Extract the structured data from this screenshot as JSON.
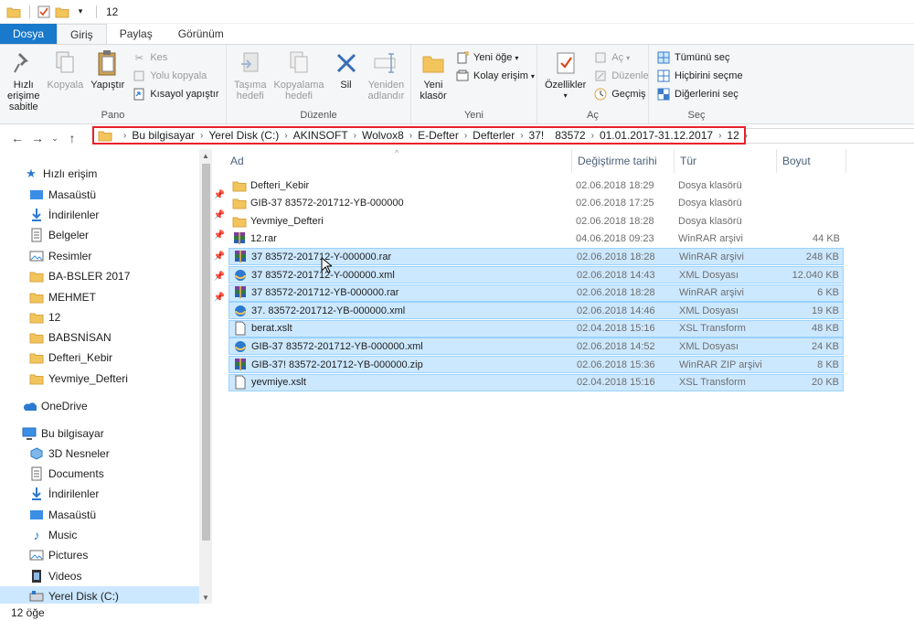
{
  "titlebar": {
    "title": "12"
  },
  "ribbon_tabs": [
    "Dosya",
    "Giriş",
    "Paylaş",
    "Görünüm"
  ],
  "ribbon": {
    "pano": {
      "label": "Pano",
      "pin_label_1": "Hızlı erişime",
      "pin_label_2": "sabitle",
      "copy_label": "Kopyala",
      "paste_label": "Yapıştır",
      "cut_label": "Kes",
      "copy_path_label": "Yolu kopyala",
      "paste_shortcut_label": "Kısayol yapıştır"
    },
    "duzenle": {
      "label": "Düzenle",
      "move_label_1": "Taşıma",
      "move_label_2": "hedefi",
      "copyto_label_1": "Kopyalama",
      "copyto_label_2": "hedefi",
      "delete_label": "Sil",
      "rename_label_1": "Yeniden",
      "rename_label_2": "adlandır"
    },
    "yeni": {
      "label": "Yeni",
      "new_folder_label_1": "Yeni",
      "new_folder_label_2": "klasör",
      "new_item_label": "Yeni öğe",
      "easy_access_label": "Kolay erişim"
    },
    "ac": {
      "label": "Aç",
      "properties_label": "Özellikler",
      "open_label": "Aç",
      "edit_label": "Düzenle",
      "history_label": "Geçmiş"
    },
    "sec": {
      "label": "Seç",
      "select_all_label": "Tümünü seç",
      "select_none_label": "Hiçbirini seçme",
      "invert_label": "Diğerlerini seç"
    }
  },
  "address": {
    "crumbs": [
      "Bu bilgisayar",
      "Yerel Disk (C:)",
      "AKINSOFT",
      "Wolvox8",
      "E-Defter",
      "Defterler",
      "37!",
      "83572",
      "01.01.2017-31.12.2017",
      "12"
    ]
  },
  "navpane": {
    "quick_access": "Hızlı erişim",
    "items": [
      {
        "label": "Masaüstü",
        "icon": "desktop-icon",
        "pinned": true
      },
      {
        "label": "İndirilenler",
        "icon": "download-icon",
        "pinned": true
      },
      {
        "label": "Belgeler",
        "icon": "documents-icon",
        "pinned": true
      },
      {
        "label": "Resimler",
        "icon": "pictures-icon",
        "pinned": true
      },
      {
        "label": "BA-BSLER 2017",
        "icon": "folder-icon",
        "pinned": true
      },
      {
        "label": "MEHMET",
        "icon": "folder-icon",
        "pinned": true
      },
      {
        "label": "12",
        "icon": "folder-icon",
        "pinned": false
      },
      {
        "label": "BABSNİSAN",
        "icon": "folder-icon",
        "pinned": false
      },
      {
        "label": "Defteri_Kebir",
        "icon": "folder-icon",
        "pinned": false
      },
      {
        "label": "Yevmiye_Defteri",
        "icon": "folder-icon",
        "pinned": false
      }
    ],
    "onedrive": "OneDrive",
    "this_pc": "Bu bilgisayar",
    "pc_items": [
      {
        "label": "3D Nesneler",
        "icon": "3d-objects-icon"
      },
      {
        "label": "Documents",
        "icon": "documents-icon"
      },
      {
        "label": "İndirilenler",
        "icon": "download-icon"
      },
      {
        "label": "Masaüstü",
        "icon": "desktop-icon"
      },
      {
        "label": "Music",
        "icon": "music-icon"
      },
      {
        "label": "Pictures",
        "icon": "pictures-icon"
      },
      {
        "label": "Videos",
        "icon": "videos-icon"
      },
      {
        "label": "Yerel Disk (C:)",
        "icon": "disk-icon"
      }
    ]
  },
  "columns": {
    "name": "Ad",
    "date": "Değiştirme tarihi",
    "type": "Tür",
    "size": "Boyut"
  },
  "files": [
    {
      "name": "Defteri_Kebir",
      "date": "02.06.2018 18:29",
      "type": "Dosya klasörü",
      "size": "",
      "icon": "folder-icon",
      "selected": false
    },
    {
      "name": "GIB-37      83572-201712-YB-000000",
      "date": "02.06.2018 17:25",
      "type": "Dosya klasörü",
      "size": "",
      "icon": "folder-icon",
      "selected": false
    },
    {
      "name": "Yevmiye_Defteri",
      "date": "02.06.2018 18:28",
      "type": "Dosya klasörü",
      "size": "",
      "icon": "folder-icon",
      "selected": false
    },
    {
      "name": "12.rar",
      "date": "04.06.2018 09:23",
      "type": "WinRAR arşivi",
      "size": "44 KB",
      "icon": "winrar-icon",
      "selected": false
    },
    {
      "name": "37        83572-201712-Y-000000.rar",
      "date": "02.06.2018 18:28",
      "type": "WinRAR arşivi",
      "size": "248 KB",
      "icon": "winrar-icon",
      "selected": true
    },
    {
      "name": "37        83572-201712-Y-000000.xml",
      "date": "02.06.2018 14:43",
      "type": "XML Dosyası",
      "size": "12.040 KB",
      "icon": "xml-icon",
      "selected": true
    },
    {
      "name": "37        83572-201712-YB-000000.rar",
      "date": "02.06.2018 18:28",
      "type": "WinRAR arşivi",
      "size": "6 KB",
      "icon": "winrar-icon",
      "selected": true
    },
    {
      "name": "37.       83572-201712-YB-000000.xml",
      "date": "02.06.2018 14:46",
      "type": "XML Dosyası",
      "size": "19 KB",
      "icon": "xml-icon",
      "selected": true
    },
    {
      "name": "berat.xslt",
      "date": "02.04.2018 15:16",
      "type": "XSL Transform",
      "size": "48 KB",
      "icon": "file-icon",
      "selected": true
    },
    {
      "name": "GIB-37        83572-201712-YB-000000.xml",
      "date": "02.06.2018 14:52",
      "type": "XML Dosyası",
      "size": "24 KB",
      "icon": "xml-icon",
      "selected": true
    },
    {
      "name": "GIB-37!       83572-201712-YB-000000.zip",
      "date": "02.06.2018 15:36",
      "type": "WinRAR ZIP arşivi",
      "size": "8 KB",
      "icon": "winrar-icon",
      "selected": true
    },
    {
      "name": "yevmiye.xslt",
      "date": "02.04.2018 15:16",
      "type": "XSL Transform",
      "size": "20 KB",
      "icon": "file-icon",
      "selected": true
    }
  ],
  "status": {
    "count": "12 öğe"
  },
  "colors": {
    "accent": "#1979ca",
    "selection": "#cce8ff",
    "highlight_border": "#e8202a",
    "folder": "#f2c55c"
  }
}
